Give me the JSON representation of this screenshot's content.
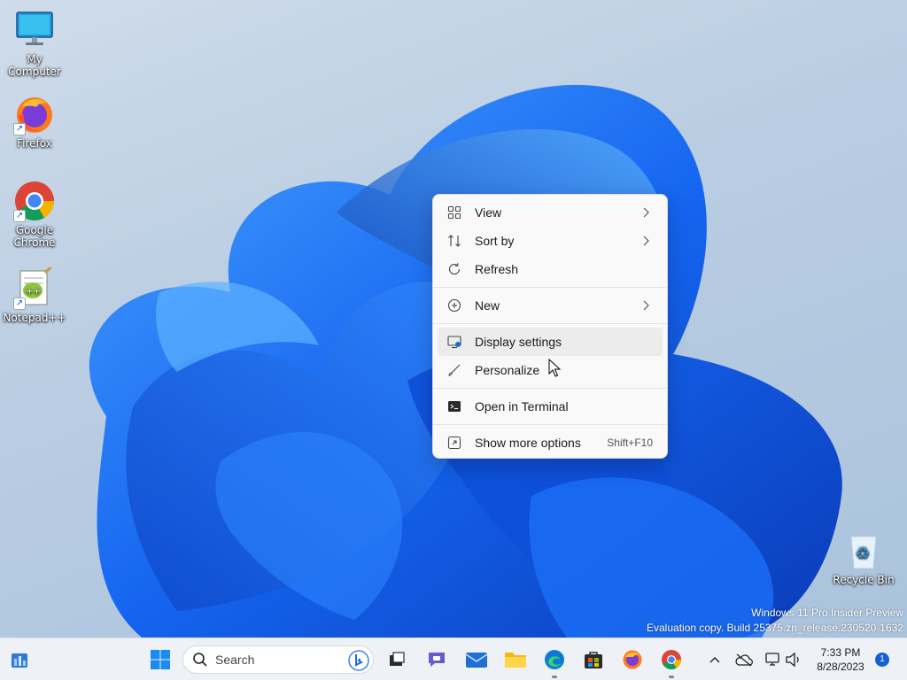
{
  "desktop": {
    "icons": [
      {
        "label": "My Computer",
        "icon": "monitor-icon"
      },
      {
        "label": "Firefox",
        "icon": "firefox-icon"
      },
      {
        "label": "Google Chrome",
        "icon": "chrome-icon"
      },
      {
        "label": "Notepad++",
        "icon": "notepad-plus-plus-icon"
      },
      {
        "label": "Recycle Bin",
        "icon": "recycle-bin-icon"
      }
    ]
  },
  "context_menu": {
    "items": [
      {
        "label": "View",
        "icon": "grid-icon",
        "submenu": true
      },
      {
        "label": "Sort by",
        "icon": "sort-icon",
        "submenu": true
      },
      {
        "label": "Refresh",
        "icon": "refresh-icon",
        "submenu": false
      },
      {
        "label": "New",
        "icon": "plus-circle-icon",
        "submenu": true
      },
      {
        "label": "Display settings",
        "icon": "display-icon",
        "submenu": false
      },
      {
        "label": "Personalize",
        "icon": "brush-icon",
        "submenu": false
      },
      {
        "label": "Open in Terminal",
        "icon": "terminal-icon",
        "submenu": false
      },
      {
        "label": "Show more options",
        "icon": "more-options-icon",
        "shortcut": "Shift+F10"
      }
    ],
    "hovered": "Display settings"
  },
  "watermark": {
    "line1": "Windows 11 Pro Insider Preview",
    "line2": "Evaluation copy. Build 25375.zn_release.230520-1632"
  },
  "taskbar": {
    "search_placeholder": "Search",
    "apps": [
      "widgets-icon",
      "start-icon",
      "task-view-icon",
      "teams-chat-icon",
      "mail-icon",
      "file-explorer-icon",
      "edge-icon",
      "store-icon",
      "firefox-icon",
      "chrome-icon"
    ],
    "tray": [
      "chevron-up-icon",
      "onedrive-icon",
      "network-icon",
      "volume-icon"
    ],
    "time": "7:33 PM",
    "date": "8/28/2023",
    "notification_count": "1",
    "accent_color": "#1560d4"
  }
}
